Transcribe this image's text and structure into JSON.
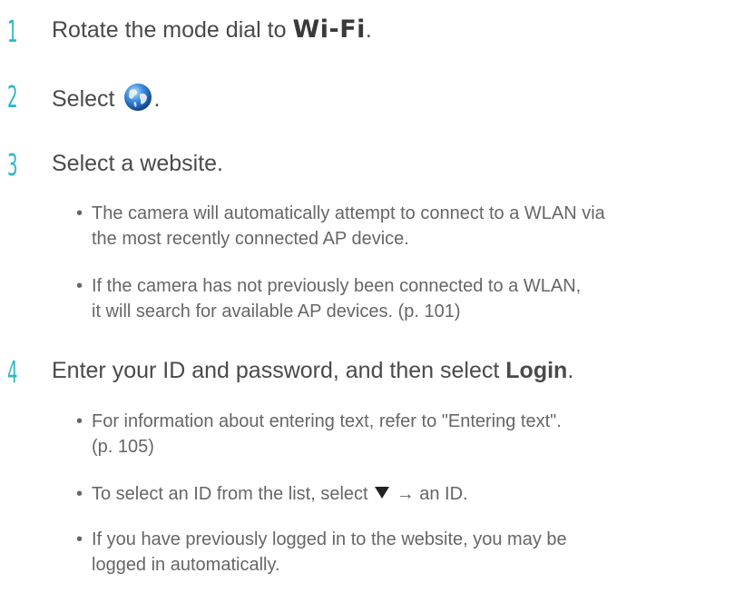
{
  "steps": [
    {
      "number": "1",
      "text_before": "Rotate the mode dial to ",
      "mode_label": "Wi-Fi",
      "text_after": "."
    },
    {
      "number": "2",
      "text_before": "Select ",
      "icon": "globe-icon",
      "text_after": "."
    },
    {
      "number": "3",
      "text": "Select a website.",
      "bullets": [
        {
          "dot": "•",
          "line1": "The camera will automatically attempt to connect to a WLAN via",
          "line2": "the most recently connected AP device."
        },
        {
          "dot": "•",
          "line1": "If the camera has not previously been connected to a WLAN,",
          "line2": "it will search for available AP devices. (p. 101)"
        }
      ]
    },
    {
      "number": "4",
      "text_before": "Enter your ID and password, and then select ",
      "bold_word": "Login",
      "text_after": ".",
      "bullets": [
        {
          "dot": "•",
          "line1": "For information about entering text, refer to \"Entering text\".",
          "line2": "(p. 105)"
        },
        {
          "dot": "•",
          "text_before": "To select an ID from the list, select ",
          "icon": "down-triangle-icon",
          "arrow": "→",
          "text_after": " an ID."
        },
        {
          "dot": "•",
          "line1": "If you have previously logged in to the website, you may be",
          "line2": "logged in automatically."
        }
      ]
    }
  ],
  "colors": {
    "step_number": "#2bb6c9",
    "step_text": "#4a4a4a",
    "bullet_text": "#666666"
  }
}
